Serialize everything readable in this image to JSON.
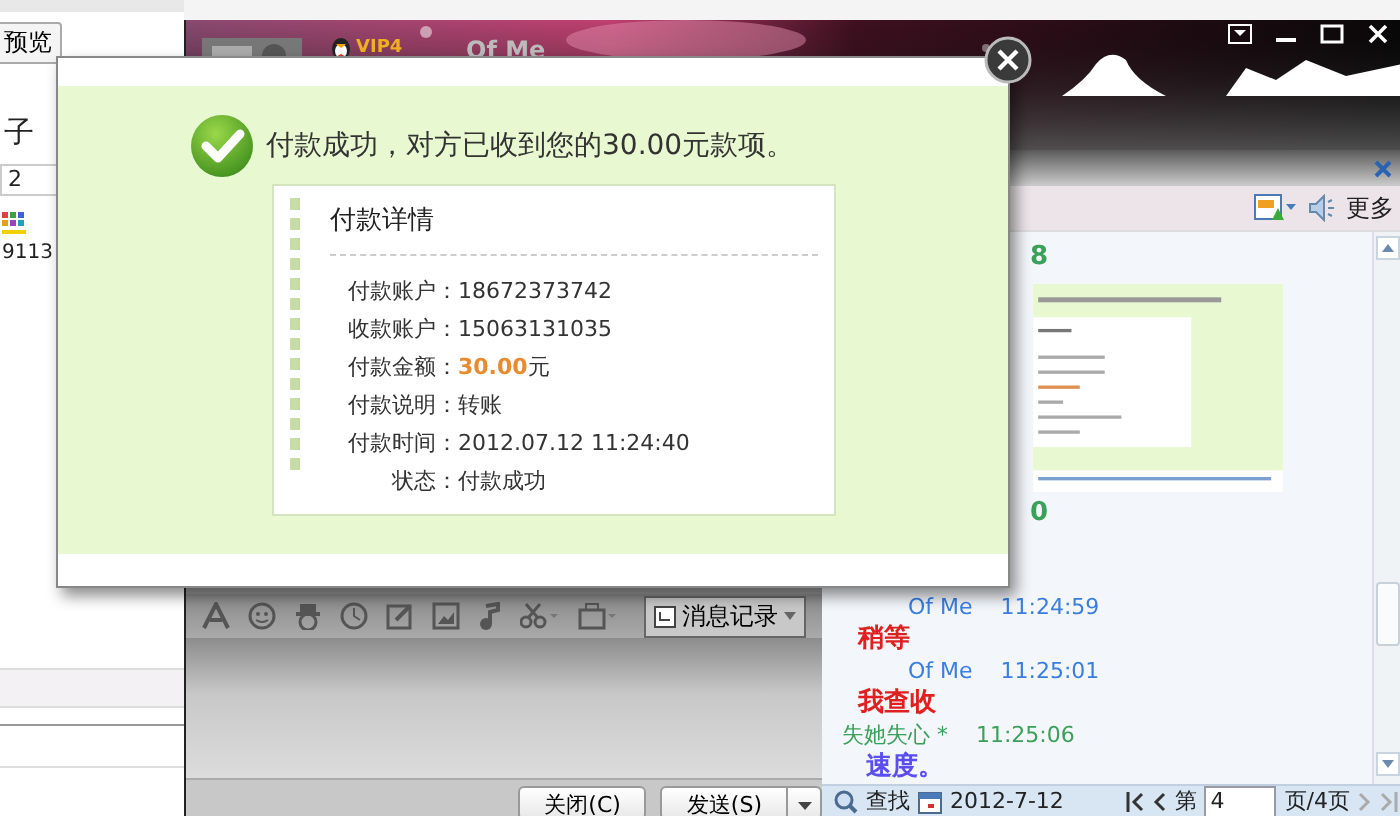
{
  "background_window": {
    "preview_button": "预览",
    "label": "子",
    "field_value": "2",
    "text": "9113"
  },
  "chat_window": {
    "vip_badge": "VIP4",
    "contact_name": "Of Me",
    "toolbar_more": "更多",
    "history_button": "消息记录",
    "close_button": "关闭(C)",
    "send_button": "发送(S)",
    "history": [
      {
        "kind": "fragment",
        "text": "8",
        "color": "#3aa05a"
      },
      {
        "kind": "screenshot"
      },
      {
        "kind": "fragment",
        "text": "0",
        "color": "#3aa05a"
      },
      {
        "kind": "header",
        "sender": "Of Me",
        "time": "11:24:59",
        "color": "#3a7ee0"
      },
      {
        "kind": "text",
        "text": "稍等",
        "color": "#e02020"
      },
      {
        "kind": "header",
        "sender": "Of Me",
        "time": "11:25:01",
        "color": "#3a7ee0"
      },
      {
        "kind": "text",
        "text": "我查收",
        "color": "#e02020"
      },
      {
        "kind": "header",
        "sender": "失她失心 *",
        "time": "11:25:06",
        "color": "#3aa05a"
      },
      {
        "kind": "text",
        "text": "速度。",
        "color": "#5a4ef0"
      }
    ],
    "history_footer": {
      "search": "查找",
      "date": "2012-7-12",
      "page_prefix": "第",
      "page_value": "4",
      "page_suffix": "页/4页"
    }
  },
  "dialog": {
    "heading": "付款成功，对方已收到您的30.00元款项。",
    "details_title": "付款详情",
    "rows": [
      {
        "kind": "plain",
        "label": "付款账户：",
        "value": "18672373742"
      },
      {
        "kind": "plain",
        "label": "收款账户：",
        "value": "15063131035"
      },
      {
        "kind": "amount",
        "label": "付款金额：",
        "value": "30.00",
        "unit": "元"
      },
      {
        "kind": "plain",
        "label": "付款说明：",
        "value": "转账"
      },
      {
        "kind": "plain",
        "label": "付款时间：",
        "value": "2012.07.12 11:24:40"
      },
      {
        "kind": "plain",
        "label": "状态：",
        "value": "付款成功"
      }
    ]
  }
}
